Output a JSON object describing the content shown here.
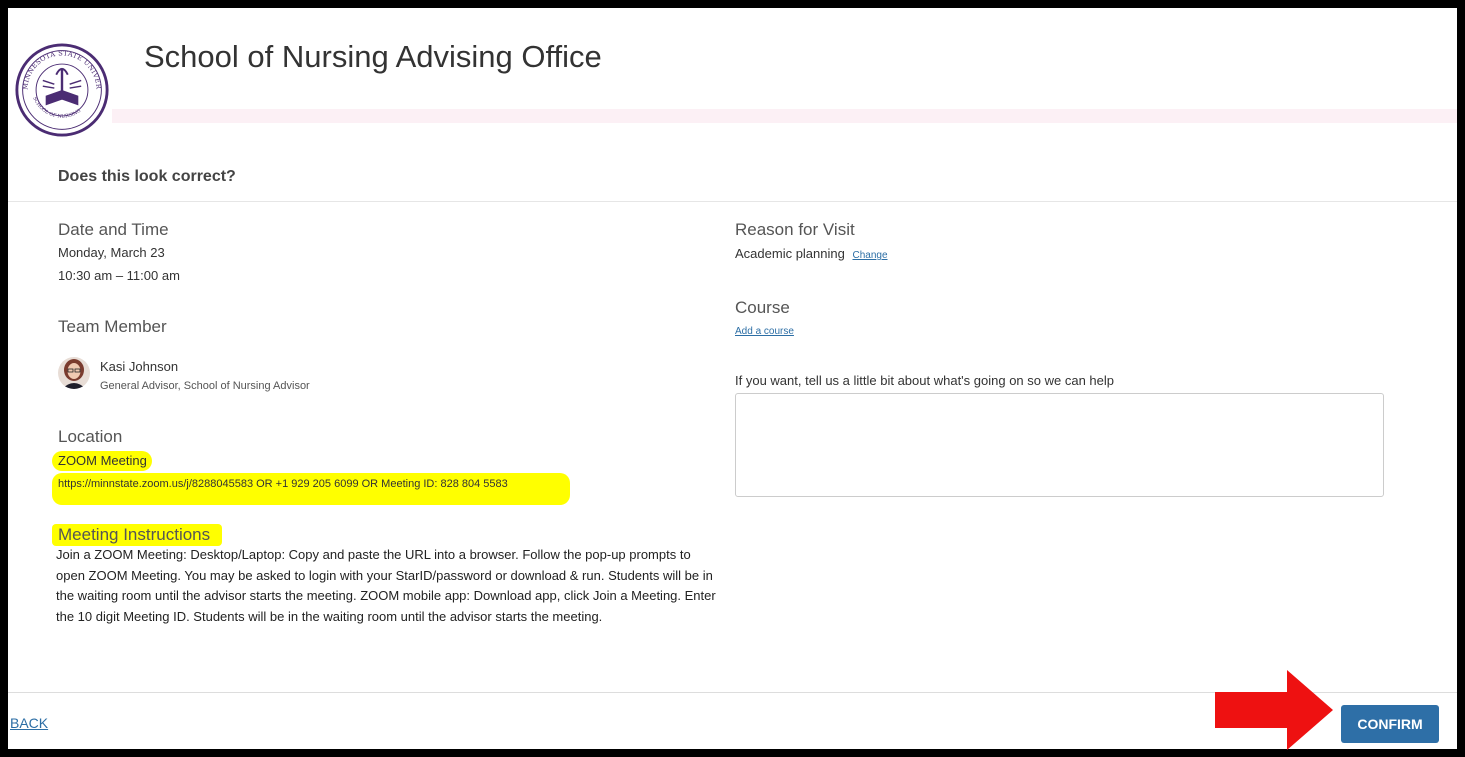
{
  "header": {
    "title": "School of Nursing Advising Office",
    "logo_text_top": "MINNESOTA STATE UNIVERSITY MANKATO",
    "logo_text_bottom": "SCHOOL OF NURSING"
  },
  "review": {
    "heading": "Does this look correct?"
  },
  "date_time": {
    "label": "Date and Time",
    "date": "Monday, March 23",
    "time": "10:30 am – 11:00 am"
  },
  "team_member": {
    "label": "Team Member",
    "name": "Kasi Johnson",
    "role": "General Advisor, School of Nursing Advisor"
  },
  "location": {
    "label": "Location",
    "type": "ZOOM Meeting",
    "details": "https://minnstate.zoom.us/j/8288045583 OR +1 929 205 6099 OR Meeting ID: 828 804 5583"
  },
  "instructions": {
    "label": "Meeting Instructions",
    "text": "Join a ZOOM Meeting: Desktop/Laptop: Copy and paste the URL into a browser. Follow the pop-up prompts to open ZOOM Meeting. You may be asked to login with your StarID/password or download & run. Students will be in the waiting room until the advisor starts the meeting. ZOOM mobile app: Download app, click Join a Meeting. Enter the 10 digit Meeting ID. Students will be in the waiting room until the advisor starts the meeting."
  },
  "reason": {
    "label": "Reason for Visit",
    "value": "Academic planning",
    "change_link": "Change"
  },
  "course": {
    "label": "Course",
    "add_link": "Add a course"
  },
  "notes": {
    "label": "If you want, tell us a little bit about what's going on so we can help",
    "value": ""
  },
  "footer": {
    "back_label": "BACK",
    "confirm_label": "CONFIRM"
  },
  "colors": {
    "highlight": "#ffff00",
    "primary_button": "#2e6fa7",
    "link": "#2c6ea5",
    "annotation_arrow": "#ee1111",
    "logo_purple": "#4b2c73"
  }
}
